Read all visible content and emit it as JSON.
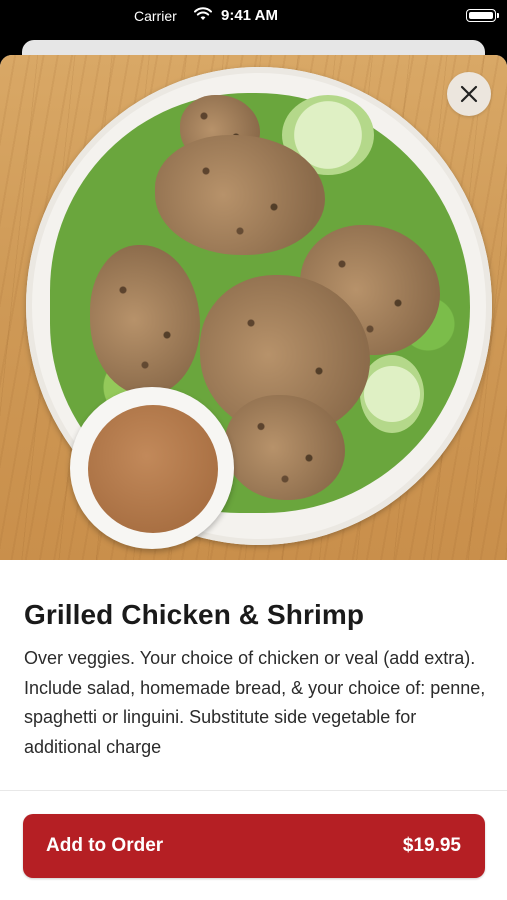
{
  "status_bar": {
    "carrier": "Carrier",
    "time": "9:41 AM"
  },
  "item": {
    "name": "Grilled Chicken & Shrimp",
    "description": "Over veggies. Your choice of chicken or veal (add extra). Include salad, homemade bread, & your choice of: penne, spaghetti or linguini. Substitute side vegetable for additional charge",
    "photo_subject": "grilled chicken and shrimp over salad with dressing cup"
  },
  "actions": {
    "close_icon": "close-icon",
    "add_label": "Add to Order",
    "price": "$19.95"
  },
  "colors": {
    "primary": "#b51f24",
    "close_bg": "#ece6de"
  }
}
